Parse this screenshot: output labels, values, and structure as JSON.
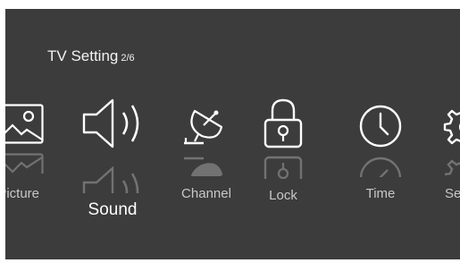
{
  "header": {
    "title": "TV Setting",
    "page": "2/6"
  },
  "menu": {
    "items": [
      {
        "label": "Picture",
        "icon": "picture-icon"
      },
      {
        "label": "Sound",
        "icon": "speaker-icon",
        "selected": true
      },
      {
        "label": "Channel",
        "icon": "satellite-dish-icon"
      },
      {
        "label": "Lock",
        "icon": "padlock-icon"
      },
      {
        "label": "Time",
        "icon": "clock-icon"
      },
      {
        "label": "Setup",
        "icon": "gear-icon"
      }
    ]
  },
  "colors": {
    "background": "#3c3c3c",
    "icon": "#ffffff",
    "label": "#c8c8c8"
  }
}
